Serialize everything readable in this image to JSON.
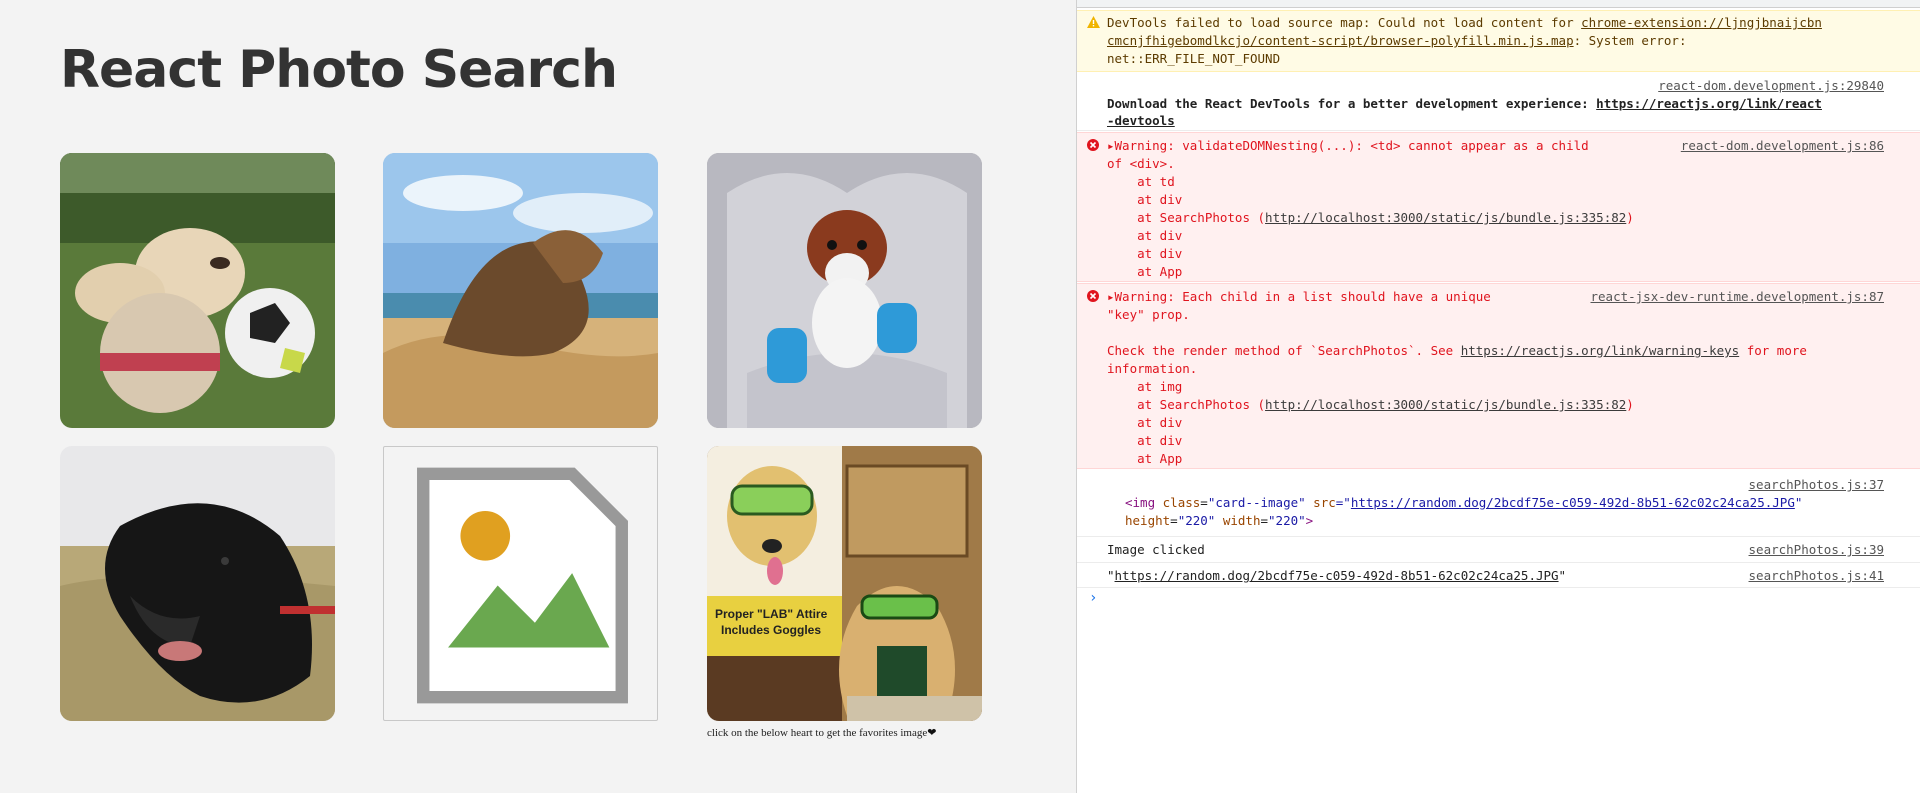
{
  "page": {
    "title": "React Photo Search",
    "hint": "click on the below heart to get the favorites image",
    "heart": "❤",
    "cards": [
      {
        "alt": "dog with soccer balls"
      },
      {
        "alt": "dog on beach"
      },
      {
        "alt": "dog in blanket"
      },
      {
        "alt": "black dog"
      },
      {
        "alt": "broken image"
      },
      {
        "alt": "lab dog with goggles"
      }
    ],
    "poster": {
      "line1": "Proper \"LAB\" Attire",
      "line2": "Includes Goggles"
    }
  },
  "console": {
    "warning": {
      "l1a": "DevTools failed to load source map: Could not load content for ",
      "l1b": "chrome-extension://ljngjbnaijcbn",
      "l2": "cmcnjfhigebomdlkcjo/content-script/browser-polyfill.min.js.map",
      "l2b": ": System error:",
      "l3": "net::ERR_FILE_NOT_FOUND"
    },
    "devtools": {
      "src": "react-dom.development.js:29840",
      "l1": "Download the React DevTools for a better development experience: ",
      "l1link": "https://reactjs.org/link/react",
      "l2link": "-devtools"
    },
    "error1": {
      "src": "react-dom.development.js:86",
      "l1": "Warning: validateDOMNesting(...): <td> cannot appear as a child",
      "l2": "of <div>.",
      "l3": "    at td",
      "l4": "    at div",
      "l5a": "    at SearchPhotos (",
      "l5link": "http://localhost:3000/static/js/bundle.js:335:82",
      "l5b": ")",
      "l6": "    at div",
      "l7": "    at div",
      "l8": "    at App"
    },
    "error2": {
      "src": "react-jsx-dev-runtime.development.js:87",
      "l1": "Warning: Each child in a list should have a unique",
      "l2": "\"key\" prop.",
      "l4a": "Check the render method of `SearchPhotos`. See ",
      "l4link": "https://reactjs.org/link/warning-keys",
      "l4b": " for more",
      "l5": "information.",
      "l6": "    at img",
      "l7a": "    at SearchPhotos (",
      "l7link": "http://localhost:3000/static/js/bundle.js:335:82",
      "l7b": ")",
      "l8": "    at div",
      "l9": "    at div",
      "l10": "    at App"
    },
    "log1": {
      "src": "searchPhotos.js:37",
      "tag_open": "<img ",
      "a1": "class",
      "v1": "\"card--image\"",
      "a2": " src",
      "v2pre": "=\"",
      "v2link": "https://random.dog/2bcdf75e-c059-492d-8b51-62c02c24ca25.JPG",
      "v2post": "\"",
      "a3": "height",
      "v3": "\"220\"",
      "a4": " width",
      "v4": "\"220\"",
      "tag_close": ">"
    },
    "log2": {
      "src": "searchPhotos.js:39",
      "text": "Image clicked"
    },
    "log3": {
      "src": "searchPhotos.js:41",
      "pre": "\"",
      "link": "https://random.dog/2bcdf75e-c059-492d-8b51-62c02c24ca25.JPG",
      "post": "\""
    },
    "prompt": "›"
  },
  "colors": {
    "error": "#e0141e",
    "warning_bg": "#fffbe5",
    "error_bg": "#fff0f0",
    "page_bg": "#f3f3f3"
  }
}
